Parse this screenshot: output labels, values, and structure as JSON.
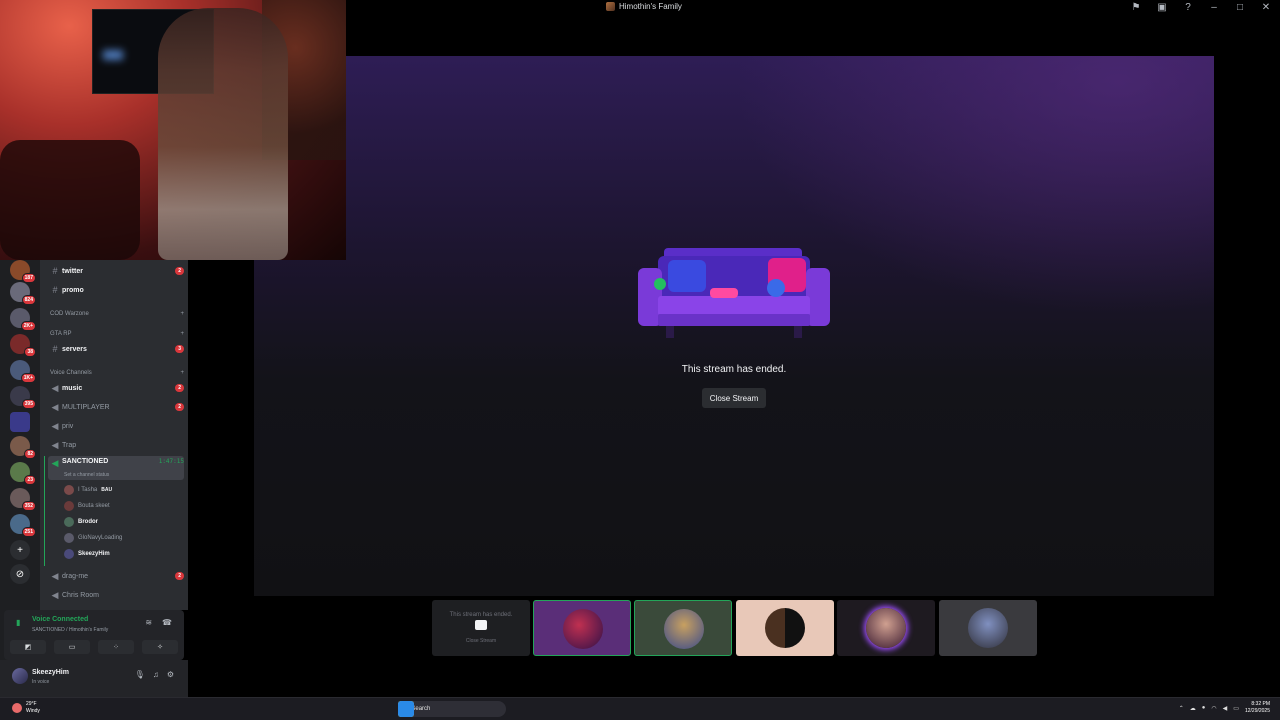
{
  "window": {
    "title": "Himothin's Family",
    "icons": [
      "flag-icon",
      "inbox-icon",
      "help-icon",
      "minimize-icon",
      "maximize-icon",
      "close-icon"
    ]
  },
  "rail": {
    "servers": [
      {
        "badge": "187"
      },
      {
        "badge": "824"
      },
      {
        "badge": "2K+"
      },
      {
        "badge": "38"
      },
      {
        "badge": "1K+"
      },
      {
        "badge": "395"
      },
      {
        "badge": ""
      },
      {
        "badge": "82"
      },
      {
        "badge": "23"
      },
      {
        "badge": "352"
      },
      {
        "badge": "251"
      }
    ]
  },
  "channels": {
    "text_top": [
      {
        "name": "twitter",
        "count": "2"
      },
      {
        "name": "promo",
        "count": ""
      }
    ],
    "categories": {
      "cod": "COD Warzone",
      "gta": "GTA RP",
      "voice": "Voice Channels"
    },
    "servers_channel": {
      "name": "servers",
      "count": "3"
    },
    "voice": [
      {
        "name": "music",
        "count": "2"
      },
      {
        "name": "MULTIPLAYER",
        "count": "2"
      },
      {
        "name": "priv",
        "count": ""
      },
      {
        "name": "Trap",
        "count": ""
      }
    ],
    "active": {
      "name": "SANCTIONED",
      "timer": "1:47:15",
      "status": "Set a channel status"
    },
    "members": [
      {
        "name": "I Tasha",
        "tag": "BAU"
      },
      {
        "name": "Bouta skeet",
        "tag": ""
      },
      {
        "name": "Brodor",
        "tag": ""
      },
      {
        "name": "GloNavyLoading",
        "tag": ""
      },
      {
        "name": "SkeezyHim",
        "tag": ""
      }
    ],
    "after": [
      {
        "name": "drag-me",
        "count": "2"
      },
      {
        "name": "Chris Room",
        "count": ""
      }
    ]
  },
  "voice_panel": {
    "status": "Voice Connected",
    "location": "SANCTIONED / Himothin's Family"
  },
  "user_panel": {
    "name": "SkeezyHim",
    "status": "In voice"
  },
  "stream": {
    "ended_text": "This stream has ended.",
    "close_label": "Close Stream"
  },
  "tiles": {
    "ended_text": "This stream has ended.",
    "close_label": "Close Stream"
  },
  "taskbar": {
    "temp": "29°F",
    "weather": "Windy",
    "search_label": "Search",
    "time": "8:32 PM",
    "date": "12/29/2025"
  },
  "colors": {
    "accent_green": "#23a559",
    "badge_red": "#da373c",
    "stream_purple": "#2e1d55"
  }
}
